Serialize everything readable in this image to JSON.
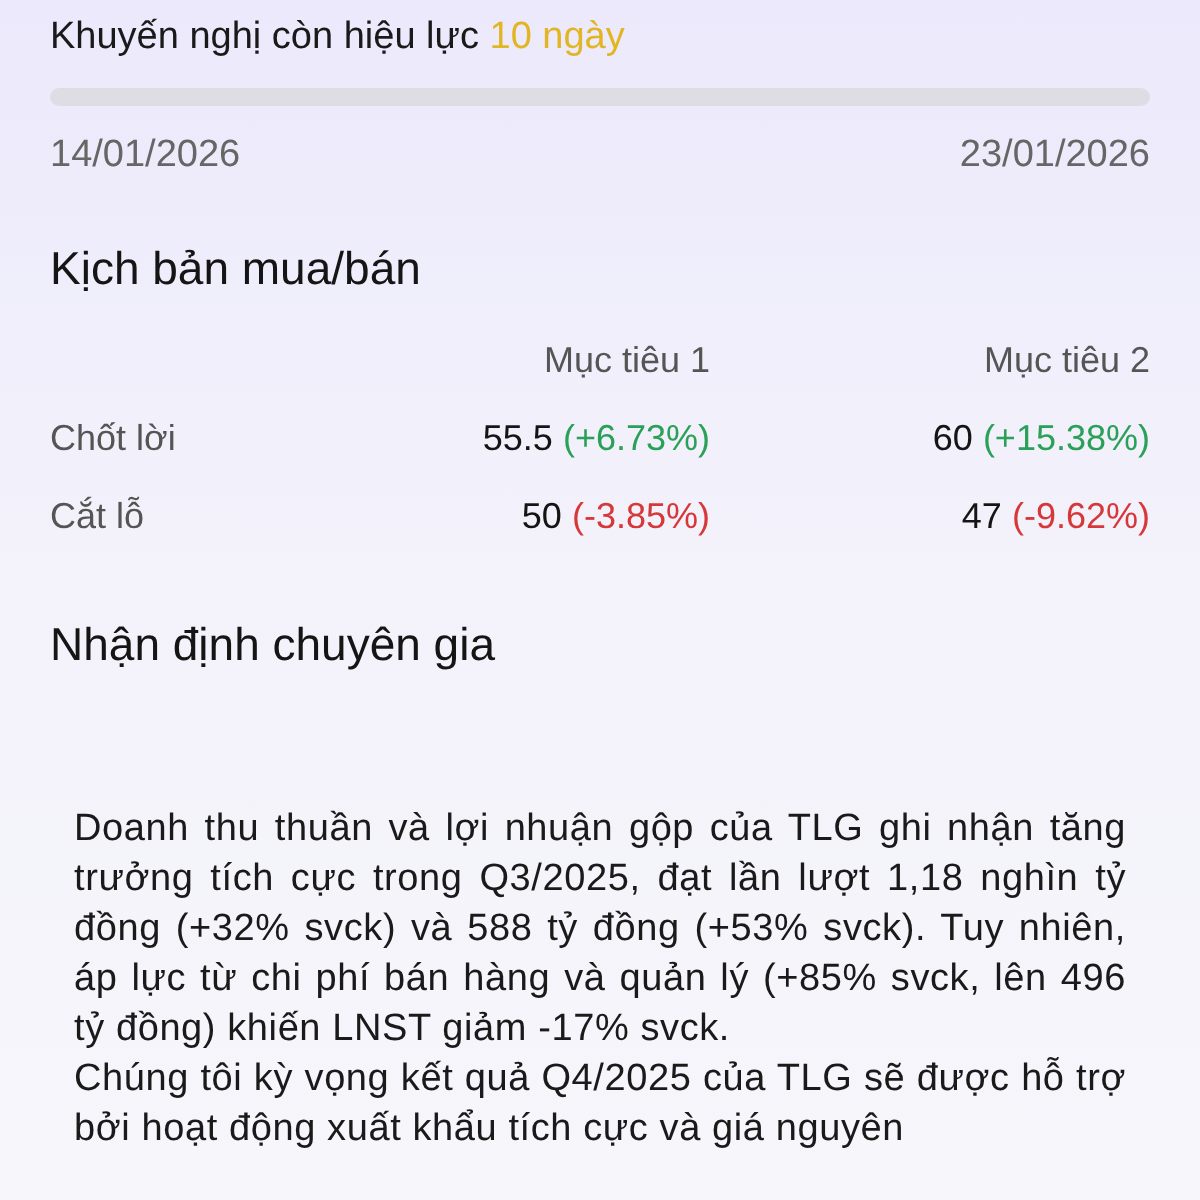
{
  "validity": {
    "label": "Khuyến nghị còn hiệu lực",
    "remaining": "10 ngày",
    "start_date": "14/01/2026",
    "end_date": "23/01/2026"
  },
  "scenario": {
    "title": "Kịch bản mua/bán",
    "columns": [
      "Mục tiêu 1",
      "Mục tiêu 2"
    ],
    "rows": [
      {
        "label": "Chốt lời",
        "cells": [
          {
            "price": "55.5",
            "change": "(+6.73%)",
            "color": "#2aa058"
          },
          {
            "price": "60",
            "change": "(+15.38%)",
            "color": "#2aa058"
          }
        ]
      },
      {
        "label": "Cắt lỗ",
        "cells": [
          {
            "price": "50",
            "change": "(-3.85%)",
            "color": "#d6383a"
          },
          {
            "price": "47",
            "change": "(-9.62%)",
            "color": "#d6383a"
          }
        ]
      }
    ]
  },
  "expert": {
    "title": "Nhận định chuyên gia",
    "paragraphs": [
      "Doanh thu thuần và lợi nhuận gộp của TLG ghi nhận tăng trưởng tích cực trong Q3/2025, đạt lần lượt 1,18 nghìn tỷ đồng (+32% svck) và 588 tỷ đồng (+53% svck). Tuy nhiên, áp lực từ chi phí bán hàng và quản lý (+85% svck, lên 496 tỷ đồng) khiến LNST giảm -17% svck.",
      "Chúng tôi kỳ vọng kết quả Q4/2025 của TLG sẽ được hỗ trợ bởi hoạt động xuất khẩu tích cực và giá nguyên"
    ]
  }
}
